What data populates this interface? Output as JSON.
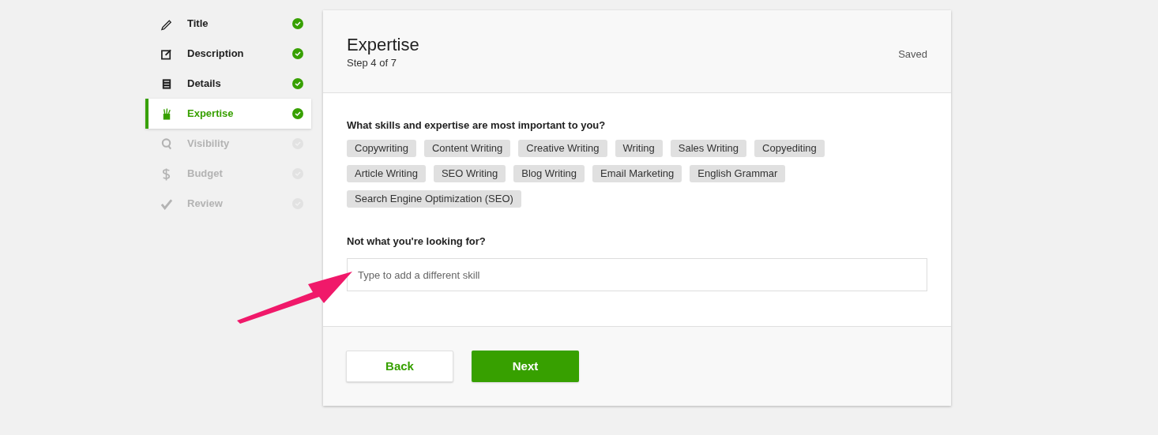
{
  "steps": [
    {
      "label": "Title",
      "completed": true,
      "selected": false,
      "disabled": false
    },
    {
      "label": "Description",
      "completed": true,
      "selected": false,
      "disabled": false
    },
    {
      "label": "Details",
      "completed": true,
      "selected": false,
      "disabled": false
    },
    {
      "label": "Expertise",
      "completed": true,
      "selected": true,
      "disabled": false
    },
    {
      "label": "Visibility",
      "completed": false,
      "selected": false,
      "disabled": true
    },
    {
      "label": "Budget",
      "completed": false,
      "selected": false,
      "disabled": true
    },
    {
      "label": "Review",
      "completed": false,
      "selected": false,
      "disabled": true
    }
  ],
  "header": {
    "title": "Expertise",
    "subtitle": "Step 4 of 7",
    "status": "Saved"
  },
  "skills_question": "What skills and expertise are most important to you?",
  "skills": [
    "Copywriting",
    "Content Writing",
    "Creative Writing",
    "Writing",
    "Sales Writing",
    "Copyediting",
    "Article Writing",
    "SEO Writing",
    "Blog Writing",
    "Email Marketing",
    "English Grammar",
    "Search Engine Optimization (SEO)"
  ],
  "other_label": "Not what you're looking for?",
  "skill_input": {
    "placeholder": "Type to add a different skill"
  },
  "buttons": [
    {
      "label": "Back",
      "kind": "secondary"
    },
    {
      "label": "Next",
      "kind": "primary"
    }
  ]
}
